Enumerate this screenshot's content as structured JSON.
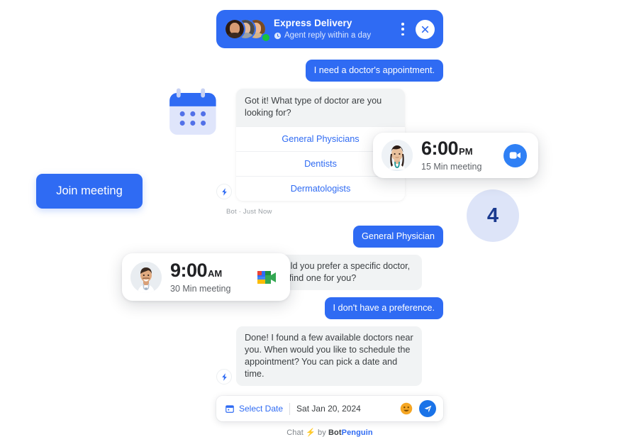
{
  "header": {
    "title": "Express Delivery",
    "subtitle": "Agent reply within a day",
    "clock_icon": "clock-icon",
    "kebab_icon": "kebab-menu-icon",
    "close_icon": "close-icon",
    "online_status": "online",
    "brand_color": "#2f6bf3"
  },
  "messages": [
    {
      "id": "m1",
      "sender": "user",
      "text": "I need a doctor's appointment."
    },
    {
      "id": "m2",
      "sender": "bot",
      "text": "Got it! What type of doctor are you looking for?"
    },
    {
      "id": "m3",
      "sender": "user",
      "text": "General Physician"
    },
    {
      "id": "m4",
      "sender": "bot",
      "text": "Great! Would you prefer a specific doctor, or should I find one for you?"
    },
    {
      "id": "m5",
      "sender": "user",
      "text": "I don't have a preference."
    },
    {
      "id": "m6",
      "sender": "bot",
      "text": "Done! I found a few available doctors near you. When would you like to schedule the appointment? You can pick a date and time."
    }
  ],
  "options_card": {
    "prompt": "Got it! What type of doctor are you looking for?",
    "items": [
      {
        "label": "General Physicians"
      },
      {
        "label": "Dentists"
      },
      {
        "label": "Dermatologists"
      }
    ],
    "meta": "Bot · Just Now"
  },
  "input_bar": {
    "calendar_icon": "calendar-icon",
    "select_date_label": "Select Date",
    "date_value": "Sat Jan 20, 2024",
    "emoji_icon": "smiley-emoji-icon",
    "send_icon": "send-paper-plane-icon"
  },
  "branding": {
    "prefix": "Chat",
    "bolt": "⚡",
    "by": "by",
    "name_bot": "Bot",
    "name_penguin": "Penguin"
  },
  "floating": {
    "join_meeting_label": "Join meeting",
    "badge_count": "4",
    "calendar_illustration": "calendar-illustration"
  },
  "meeting_cards": [
    {
      "id": "pm",
      "time": "6:00",
      "ampm": "PM",
      "duration": "15 Min meeting",
      "provider_icon": "zoom-video-icon",
      "avatar": "female-doctor-avatar"
    },
    {
      "id": "am",
      "time": "9:00",
      "ampm": "AM",
      "duration": "30 Min meeting",
      "provider_icon": "google-meet-icon",
      "avatar": "male-doctor-avatar"
    }
  ],
  "colors": {
    "accent_blue": "#2f6bf3",
    "bot_bubble": "#f1f3f4",
    "badge_bg": "#dde4f8",
    "badge_text": "#1a3a8f",
    "online_green": "#17c13e",
    "emoji_orange": "#f5a623"
  }
}
